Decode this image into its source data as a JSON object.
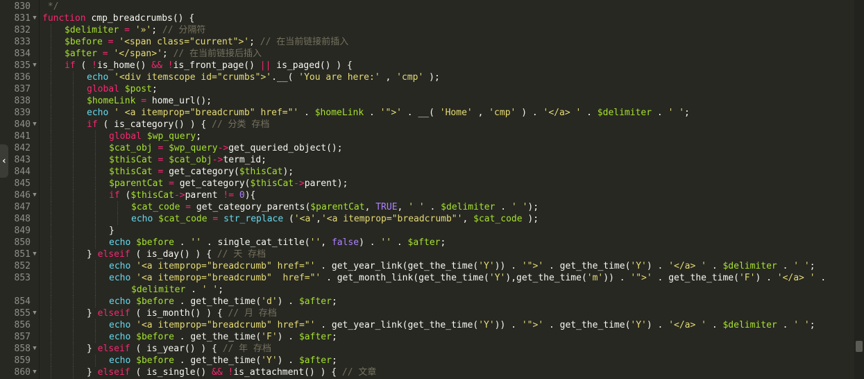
{
  "rows": [
    {
      "ln": "830",
      "fold": "",
      "indent": 0,
      "cont": false,
      "tokens": [
        [
          "c",
          " */"
        ]
      ]
    },
    {
      "ln": "831",
      "fold": "▼",
      "indent": 0,
      "cont": false,
      "tokens": [
        [
          "k",
          "function"
        ],
        [
          "p",
          " cmp_breadcrumbs() {"
        ]
      ]
    },
    {
      "ln": "832",
      "fold": "",
      "indent": 1,
      "cont": false,
      "tokens": [
        [
          "v",
          "$delimiter"
        ],
        [
          "p",
          " "
        ],
        [
          "k",
          "="
        ],
        [
          "p",
          " "
        ],
        [
          "s",
          "'»'"
        ],
        [
          "p",
          "; "
        ],
        [
          "c",
          "// 分隔符"
        ]
      ]
    },
    {
      "ln": "833",
      "fold": "",
      "indent": 1,
      "cont": false,
      "tokens": [
        [
          "v",
          "$before"
        ],
        [
          "p",
          " "
        ],
        [
          "k",
          "="
        ],
        [
          "p",
          " "
        ],
        [
          "s",
          "'<span class=\"current\">'"
        ],
        [
          "p",
          "; "
        ],
        [
          "c",
          "// 在当前链接前插入"
        ]
      ]
    },
    {
      "ln": "834",
      "fold": "",
      "indent": 1,
      "cont": false,
      "tokens": [
        [
          "v",
          "$after"
        ],
        [
          "p",
          " "
        ],
        [
          "k",
          "="
        ],
        [
          "p",
          " "
        ],
        [
          "s",
          "'</span>'"
        ],
        [
          "p",
          "; "
        ],
        [
          "c",
          "// 在当前链接后插入"
        ]
      ]
    },
    {
      "ln": "835",
      "fold": "▼",
      "indent": 1,
      "cont": false,
      "tokens": [
        [
          "k",
          "if"
        ],
        [
          "p",
          " ( "
        ],
        [
          "k",
          "!"
        ],
        [
          "p",
          "is_home() "
        ],
        [
          "k",
          "&&"
        ],
        [
          "p",
          " "
        ],
        [
          "k",
          "!"
        ],
        [
          "p",
          "is_front_page() "
        ],
        [
          "k",
          "||"
        ],
        [
          "p",
          " is_paged() ) {"
        ]
      ]
    },
    {
      "ln": "836",
      "fold": "",
      "indent": 2,
      "cont": false,
      "tokens": [
        [
          "b",
          "echo"
        ],
        [
          "p",
          " "
        ],
        [
          "s",
          "'<div itemscope id=\"crumbs\">'"
        ],
        [
          "p",
          "."
        ],
        [
          "p",
          "__( "
        ],
        [
          "s",
          "'You are here:'"
        ],
        [
          "p",
          " , "
        ],
        [
          "s",
          "'cmp'"
        ],
        [
          "p",
          " );"
        ]
      ]
    },
    {
      "ln": "837",
      "fold": "",
      "indent": 2,
      "cont": false,
      "tokens": [
        [
          "k",
          "global"
        ],
        [
          "p",
          " "
        ],
        [
          "v",
          "$post"
        ],
        [
          "p",
          ";"
        ]
      ]
    },
    {
      "ln": "838",
      "fold": "",
      "indent": 2,
      "cont": false,
      "tokens": [
        [
          "v",
          "$homeLink"
        ],
        [
          "p",
          " "
        ],
        [
          "k",
          "="
        ],
        [
          "p",
          " home_url();"
        ]
      ]
    },
    {
      "ln": "839",
      "fold": "",
      "indent": 2,
      "cont": false,
      "tokens": [
        [
          "b",
          "echo"
        ],
        [
          "p",
          " "
        ],
        [
          "s",
          "' <a itemprop=\"breadcrumb\" href=\"'"
        ],
        [
          "p",
          " . "
        ],
        [
          "v",
          "$homeLink"
        ],
        [
          "p",
          " . "
        ],
        [
          "s",
          "'\">'"
        ],
        [
          "p",
          " . __( "
        ],
        [
          "s",
          "'Home'"
        ],
        [
          "p",
          " , "
        ],
        [
          "s",
          "'cmp'"
        ],
        [
          "p",
          " ) . "
        ],
        [
          "s",
          "'</a> '"
        ],
        [
          "p",
          " . "
        ],
        [
          "v",
          "$delimiter"
        ],
        [
          "p",
          " . "
        ],
        [
          "s",
          "' '"
        ],
        [
          "p",
          ";"
        ]
      ]
    },
    {
      "ln": "840",
      "fold": "▼",
      "indent": 2,
      "cont": false,
      "tokens": [
        [
          "k",
          "if"
        ],
        [
          "p",
          " ( is_category() ) { "
        ],
        [
          "c",
          "// 分类 存档"
        ]
      ]
    },
    {
      "ln": "841",
      "fold": "",
      "indent": 3,
      "cont": false,
      "tokens": [
        [
          "k",
          "global"
        ],
        [
          "p",
          " "
        ],
        [
          "v",
          "$wp_query"
        ],
        [
          "p",
          ";"
        ]
      ]
    },
    {
      "ln": "842",
      "fold": "",
      "indent": 3,
      "cont": false,
      "tokens": [
        [
          "v",
          "$cat_obj"
        ],
        [
          "p",
          " "
        ],
        [
          "k",
          "="
        ],
        [
          "p",
          " "
        ],
        [
          "v",
          "$wp_query"
        ],
        [
          "k",
          "->"
        ],
        [
          "p",
          "get_queried_object();"
        ]
      ]
    },
    {
      "ln": "843",
      "fold": "",
      "indent": 3,
      "cont": false,
      "tokens": [
        [
          "v",
          "$thisCat"
        ],
        [
          "p",
          " "
        ],
        [
          "k",
          "="
        ],
        [
          "p",
          " "
        ],
        [
          "v",
          "$cat_obj"
        ],
        [
          "k",
          "->"
        ],
        [
          "p",
          "term_id;"
        ]
      ]
    },
    {
      "ln": "844",
      "fold": "",
      "indent": 3,
      "cont": false,
      "tokens": [
        [
          "v",
          "$thisCat"
        ],
        [
          "p",
          " "
        ],
        [
          "k",
          "="
        ],
        [
          "p",
          " get_category("
        ],
        [
          "v",
          "$thisCat"
        ],
        [
          "p",
          ");"
        ]
      ]
    },
    {
      "ln": "845",
      "fold": "",
      "indent": 3,
      "cont": false,
      "tokens": [
        [
          "v",
          "$parentCat"
        ],
        [
          "p",
          " "
        ],
        [
          "k",
          "="
        ],
        [
          "p",
          " get_category("
        ],
        [
          "v",
          "$thisCat"
        ],
        [
          "k",
          "->"
        ],
        [
          "p",
          "parent);"
        ]
      ]
    },
    {
      "ln": "846",
      "fold": "▼",
      "indent": 3,
      "cont": false,
      "tokens": [
        [
          "k",
          "if"
        ],
        [
          "p",
          " ("
        ],
        [
          "v",
          "$thisCat"
        ],
        [
          "k",
          "->"
        ],
        [
          "p",
          "parent "
        ],
        [
          "k",
          "!="
        ],
        [
          "p",
          " "
        ],
        [
          "n",
          "0"
        ],
        [
          "p",
          "){"
        ]
      ]
    },
    {
      "ln": "847",
      "fold": "",
      "indent": 4,
      "cont": false,
      "tokens": [
        [
          "v",
          "$cat_code"
        ],
        [
          "p",
          " "
        ],
        [
          "k",
          "="
        ],
        [
          "p",
          " get_category_parents("
        ],
        [
          "v",
          "$parentCat"
        ],
        [
          "p",
          ", "
        ],
        [
          "n",
          "TRUE"
        ],
        [
          "p",
          ", "
        ],
        [
          "s",
          "' '"
        ],
        [
          "p",
          " . "
        ],
        [
          "v",
          "$delimiter"
        ],
        [
          "p",
          " . "
        ],
        [
          "s",
          "' '"
        ],
        [
          "p",
          ");"
        ]
      ]
    },
    {
      "ln": "848",
      "fold": "",
      "indent": 4,
      "cont": false,
      "tokens": [
        [
          "b",
          "echo"
        ],
        [
          "p",
          " "
        ],
        [
          "v",
          "$cat_code"
        ],
        [
          "p",
          " "
        ],
        [
          "k",
          "="
        ],
        [
          "p",
          " "
        ],
        [
          "b",
          "str_replace"
        ],
        [
          "p",
          " ("
        ],
        [
          "s",
          "'<a'"
        ],
        [
          "p",
          ","
        ],
        [
          "s",
          "'<a itemprop=\"breadcrumb\"'"
        ],
        [
          "p",
          ", "
        ],
        [
          "v",
          "$cat_code"
        ],
        [
          "p",
          " );"
        ]
      ]
    },
    {
      "ln": "849",
      "fold": "",
      "indent": 3,
      "cont": false,
      "tokens": [
        [
          "p",
          "}"
        ]
      ]
    },
    {
      "ln": "850",
      "fold": "",
      "indent": 3,
      "cont": false,
      "tokens": [
        [
          "b",
          "echo"
        ],
        [
          "p",
          " "
        ],
        [
          "v",
          "$before"
        ],
        [
          "p",
          " . "
        ],
        [
          "s",
          "''"
        ],
        [
          "p",
          " . single_cat_title("
        ],
        [
          "s",
          "''"
        ],
        [
          "p",
          ", "
        ],
        [
          "n",
          "false"
        ],
        [
          "p",
          ") . "
        ],
        [
          "s",
          "''"
        ],
        [
          "p",
          " . "
        ],
        [
          "v",
          "$after"
        ],
        [
          "p",
          ";"
        ]
      ]
    },
    {
      "ln": "851",
      "fold": "▼",
      "indent": 2,
      "cont": false,
      "tokens": [
        [
          "p",
          "} "
        ],
        [
          "k",
          "elseif"
        ],
        [
          "p",
          " ( is_day() ) { "
        ],
        [
          "c",
          "// 天 存档"
        ]
      ]
    },
    {
      "ln": "852",
      "fold": "",
      "indent": 3,
      "cont": false,
      "tokens": [
        [
          "b",
          "echo"
        ],
        [
          "p",
          " "
        ],
        [
          "s",
          "'<a itemprop=\"breadcrumb\" href=\"'"
        ],
        [
          "p",
          " . get_year_link(get_the_time("
        ],
        [
          "s",
          "'Y'"
        ],
        [
          "p",
          ")) . "
        ],
        [
          "s",
          "'\">'"
        ],
        [
          "p",
          " . get_the_time("
        ],
        [
          "s",
          "'Y'"
        ],
        [
          "p",
          ") . "
        ],
        [
          "s",
          "'</a> '"
        ],
        [
          "p",
          " . "
        ],
        [
          "v",
          "$delimiter"
        ],
        [
          "p",
          " . "
        ],
        [
          "s",
          "' '"
        ],
        [
          "p",
          ";"
        ]
      ]
    },
    {
      "ln": "853",
      "fold": "",
      "indent": 3,
      "cont": false,
      "tokens": [
        [
          "b",
          "echo"
        ],
        [
          "p",
          " "
        ],
        [
          "s",
          "'<a itemprop=\"breadcrumb\"  href=\"'"
        ],
        [
          "p",
          " . get_month_link(get_the_time("
        ],
        [
          "s",
          "'Y'"
        ],
        [
          "p",
          "),get_the_time("
        ],
        [
          "s",
          "'m'"
        ],
        [
          "p",
          ")) . "
        ],
        [
          "s",
          "'\">'"
        ],
        [
          "p",
          " . get_the_time("
        ],
        [
          "s",
          "'F'"
        ],
        [
          "p",
          ") . "
        ],
        [
          "s",
          "'</a> '"
        ],
        [
          "p",
          " ."
        ]
      ]
    },
    {
      "ln": "",
      "fold": "",
      "indent": 4,
      "cont": true,
      "tokens": [
        [
          "v",
          "$delimiter"
        ],
        [
          "p",
          " . "
        ],
        [
          "s",
          "' '"
        ],
        [
          "p",
          ";"
        ]
      ]
    },
    {
      "ln": "854",
      "fold": "",
      "indent": 3,
      "cont": false,
      "tokens": [
        [
          "b",
          "echo"
        ],
        [
          "p",
          " "
        ],
        [
          "v",
          "$before"
        ],
        [
          "p",
          " . get_the_time("
        ],
        [
          "s",
          "'d'"
        ],
        [
          "p",
          ") . "
        ],
        [
          "v",
          "$after"
        ],
        [
          "p",
          ";"
        ]
      ]
    },
    {
      "ln": "855",
      "fold": "▼",
      "indent": 2,
      "cont": false,
      "tokens": [
        [
          "p",
          "} "
        ],
        [
          "k",
          "elseif"
        ],
        [
          "p",
          " ( is_month() ) { "
        ],
        [
          "c",
          "// 月 存档"
        ]
      ]
    },
    {
      "ln": "856",
      "fold": "",
      "indent": 3,
      "cont": false,
      "tokens": [
        [
          "b",
          "echo"
        ],
        [
          "p",
          " "
        ],
        [
          "s",
          "'<a itemprop=\"breadcrumb\" href=\"'"
        ],
        [
          "p",
          " . get_year_link(get_the_time("
        ],
        [
          "s",
          "'Y'"
        ],
        [
          "p",
          ")) . "
        ],
        [
          "s",
          "'\">'"
        ],
        [
          "p",
          " . get_the_time("
        ],
        [
          "s",
          "'Y'"
        ],
        [
          "p",
          ") . "
        ],
        [
          "s",
          "'</a> '"
        ],
        [
          "p",
          " . "
        ],
        [
          "v",
          "$delimiter"
        ],
        [
          "p",
          " . "
        ],
        [
          "s",
          "' '"
        ],
        [
          "p",
          ";"
        ]
      ]
    },
    {
      "ln": "857",
      "fold": "",
      "indent": 3,
      "cont": false,
      "tokens": [
        [
          "b",
          "echo"
        ],
        [
          "p",
          " "
        ],
        [
          "v",
          "$before"
        ],
        [
          "p",
          " . get_the_time("
        ],
        [
          "s",
          "'F'"
        ],
        [
          "p",
          ") . "
        ],
        [
          "v",
          "$after"
        ],
        [
          "p",
          ";"
        ]
      ]
    },
    {
      "ln": "858",
      "fold": "▼",
      "indent": 2,
      "cont": false,
      "tokens": [
        [
          "p",
          "} "
        ],
        [
          "k",
          "elseif"
        ],
        [
          "p",
          " ( is_year() ) { "
        ],
        [
          "c",
          "// 年 存档"
        ]
      ]
    },
    {
      "ln": "859",
      "fold": "",
      "indent": 3,
      "cont": false,
      "tokens": [
        [
          "b",
          "echo"
        ],
        [
          "p",
          " "
        ],
        [
          "v",
          "$before"
        ],
        [
          "p",
          " . get_the_time("
        ],
        [
          "s",
          "'Y'"
        ],
        [
          "p",
          ") . "
        ],
        [
          "v",
          "$after"
        ],
        [
          "p",
          ";"
        ]
      ]
    },
    {
      "ln": "860",
      "fold": "▼",
      "indent": 2,
      "cont": false,
      "tokens": [
        [
          "p",
          "} "
        ],
        [
          "k",
          "elseif"
        ],
        [
          "p",
          " ( is_single() "
        ],
        [
          "k",
          "&&"
        ],
        [
          "p",
          " "
        ],
        [
          "k",
          "!"
        ],
        [
          "p",
          "is_attachment() ) { "
        ],
        [
          "c",
          "// 文章"
        ]
      ]
    }
  ],
  "back_icon": "‹",
  "colors": {
    "background": "#272822",
    "keyword": "#f92672",
    "variable": "#a6e22e",
    "string": "#e6db74",
    "comment": "#75715e",
    "constant": "#ae81ff",
    "builtin": "#66d9ef"
  }
}
